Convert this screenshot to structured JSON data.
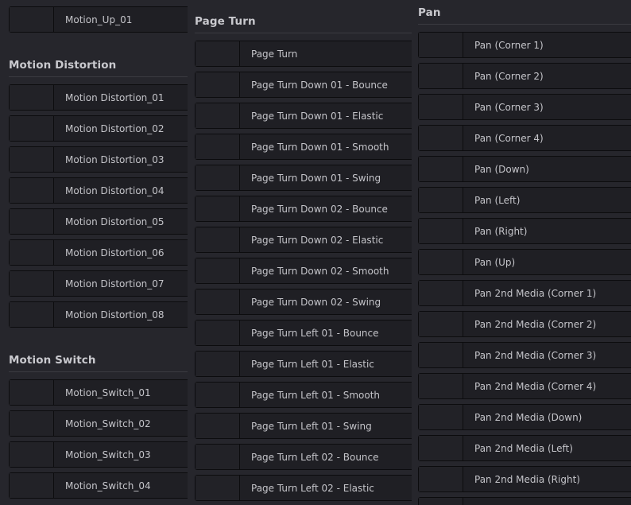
{
  "columns": [
    {
      "sections": [
        {
          "title": "",
          "items": [
            "Motion_Up_01"
          ]
        },
        {
          "title": "Motion Distortion",
          "items": [
            "Motion Distortion_01",
            "Motion Distortion_02",
            "Motion Distortion_03",
            "Motion Distortion_04",
            "Motion Distortion_05",
            "Motion Distortion_06",
            "Motion Distortion_07",
            "Motion Distortion_08"
          ]
        },
        {
          "title": "Motion Switch",
          "items": [
            "Motion_Switch_01",
            "Motion_Switch_02",
            "Motion_Switch_03",
            "Motion_Switch_04"
          ]
        }
      ]
    },
    {
      "sections": [
        {
          "title": "Page Turn",
          "items": [
            "Page Turn",
            "Page Turn Down 01 - Bounce",
            "Page Turn Down 01 - Elastic",
            "Page Turn Down 01 - Smooth",
            "Page Turn Down 01 - Swing",
            "Page Turn Down 02 - Bounce",
            "Page Turn Down 02 - Elastic",
            "Page Turn Down 02 - Smooth",
            "Page Turn Down 02 - Swing",
            "Page Turn Left 01 - Bounce",
            "Page Turn Left 01 - Elastic",
            "Page Turn Left 01 - Smooth",
            "Page Turn Left 01 - Swing",
            "Page Turn Left 02 - Bounce",
            "Page Turn Left 02 - Elastic"
          ]
        }
      ]
    },
    {
      "sections": [
        {
          "title": "Pan",
          "items": [
            "Pan (Corner 1)",
            "Pan (Corner 2)",
            "Pan (Corner 3)",
            "Pan (Corner 4)",
            "Pan (Down)",
            "Pan (Left)",
            "Pan (Right)",
            "Pan (Up)",
            "Pan 2nd Media (Corner 1)",
            "Pan 2nd Media (Corner 2)",
            "Pan 2nd Media (Corner 3)",
            "Pan 2nd Media (Corner 4)",
            "Pan 2nd Media (Down)",
            "Pan 2nd Media (Left)",
            "Pan 2nd Media (Right)"
          ]
        }
      ]
    }
  ]
}
